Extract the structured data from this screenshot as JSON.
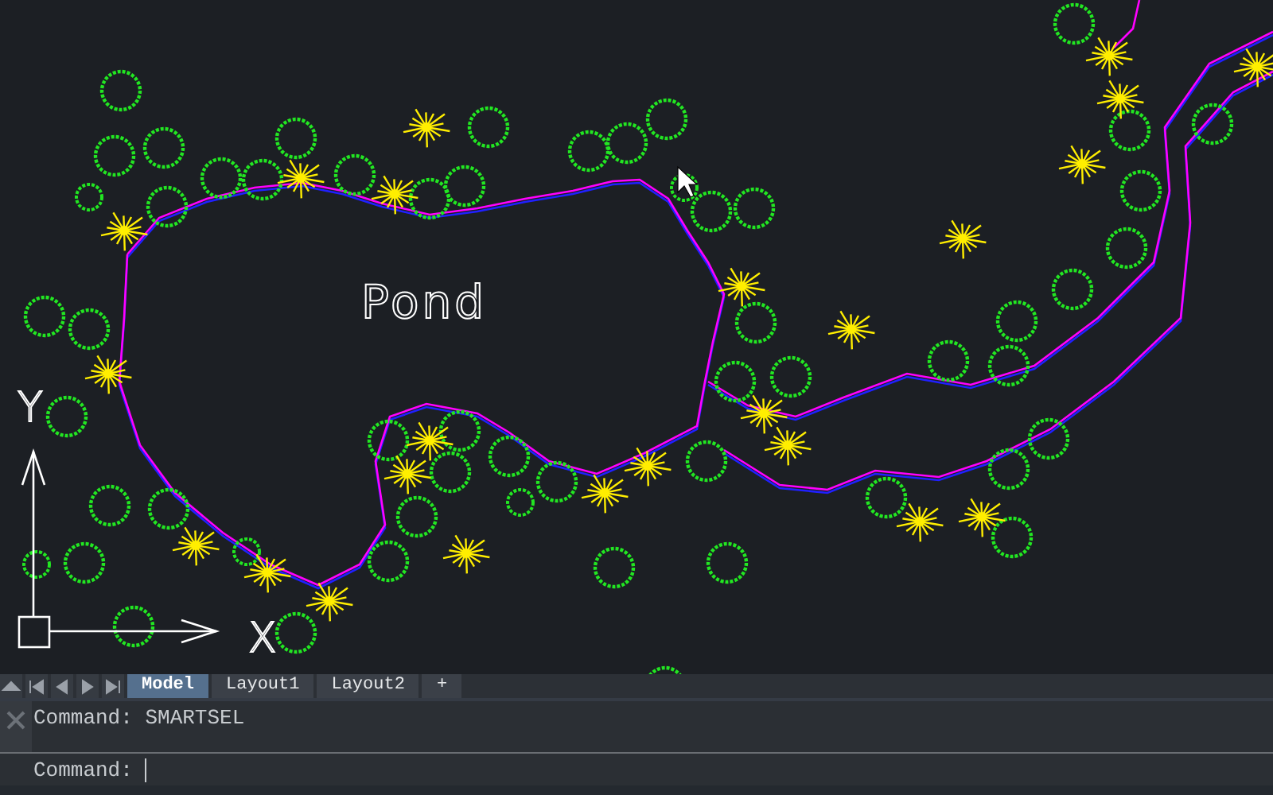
{
  "drawing": {
    "label": "Pond",
    "ucs": {
      "y_label": "Y",
      "x_label": "X"
    }
  },
  "layout_tabs": [
    {
      "label": "Model",
      "selected": true
    },
    {
      "label": "Layout1",
      "selected": false
    },
    {
      "label": "Layout2",
      "selected": false
    },
    {
      "label": "+",
      "selected": false
    }
  ],
  "command_history": [
    {
      "text": "Command: SMARTSEL"
    }
  ],
  "command_line": {
    "prompt": "Command:"
  }
}
